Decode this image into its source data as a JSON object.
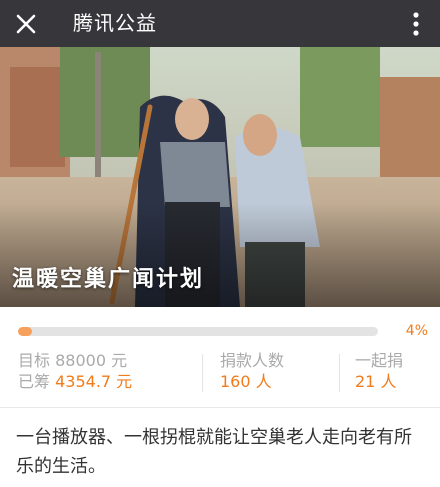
{
  "topbar": {
    "title": "腾讯公益",
    "close_icon": "close-icon",
    "more_icon": "more-vertical-icon"
  },
  "hero": {
    "title": "温暖空巢广闻计划"
  },
  "progress": {
    "percent": 4,
    "label": "4%",
    "color": "#f5a05c"
  },
  "stats": {
    "target_label": "目标",
    "target_value": "88000 元",
    "raised_label": "已筹",
    "raised_value": "4354.7 元",
    "donors_label": "捐款人数",
    "donors_value": "160 人",
    "together_label": "一起捐",
    "together_value": "21 人"
  },
  "description": "一台播放器、一根拐棍就能让空巢老人走向老有所乐的生活。",
  "colors": {
    "topbar": "#37373b",
    "accent": "#f07c1b"
  }
}
